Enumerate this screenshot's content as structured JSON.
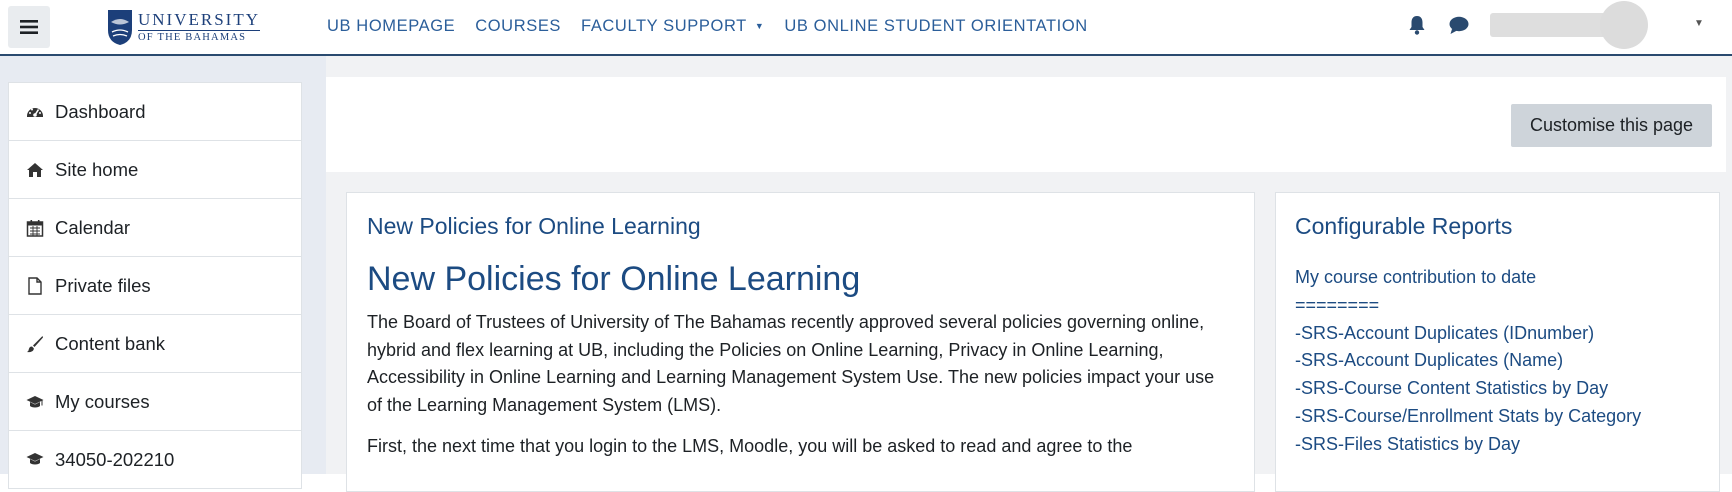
{
  "navbar": {
    "logo": {
      "badge": "UB",
      "name": "UNIVERSITY",
      "subtitle": "OF THE BAHAMAS"
    },
    "links": [
      {
        "label": "UB HOMEPAGE"
      },
      {
        "label": "COURSES"
      },
      {
        "label": "FACULTY SUPPORT",
        "has_dropdown": true
      },
      {
        "label": "UB ONLINE STUDENT ORIENTATION"
      }
    ],
    "icons": [
      "hamburger-icon",
      "bell-icon",
      "chat-icon",
      "chevron-down-icon"
    ]
  },
  "drawer": {
    "items": [
      {
        "label": "Dashboard",
        "icon": "dashboard-icon"
      },
      {
        "label": "Site home",
        "icon": "home-icon"
      },
      {
        "label": "Calendar",
        "icon": "calendar-icon"
      },
      {
        "label": "Private files",
        "icon": "file-icon"
      },
      {
        "label": "Content bank",
        "icon": "brush-icon"
      },
      {
        "label": "My courses",
        "icon": "graduation-cap-icon"
      }
    ],
    "partial_item": {
      "label": "34050-202210",
      "icon": "graduation-cap-icon"
    }
  },
  "header": {
    "customise_label": "Customise this page"
  },
  "main_block": {
    "title": "New Policies for Online Learning",
    "heading": "New Policies for Online Learning",
    "paragraphs": [
      "The Board of Trustees of University of The Bahamas recently approved several policies governing online, hybrid and flex learning at UB, including the Policies on Online Learning, Privacy in Online Learning, Accessibility in Online Learning and Learning Management System Use. The new policies impact your use of the Learning Management System (LMS).",
      "First, the next time that you login to the LMS, Moodle, you will be asked to read and agree to the"
    ]
  },
  "reports_block": {
    "title": "Configurable Reports",
    "items": [
      "My course contribution to date",
      "========",
      "-SRS-Account Duplicates (IDnumber)",
      "-SRS-Account Duplicates (Name)",
      "-SRS-Course Content Statistics by Day",
      "-SRS-Course/Enrollment Stats by Category",
      "-SRS-Files Statistics by Day"
    ]
  },
  "colors": {
    "link": "#2b5e9a",
    "heading": "#1c4b82",
    "navbar_border": "#2a4a6f",
    "drawer_bg": "#e7ebf2"
  }
}
